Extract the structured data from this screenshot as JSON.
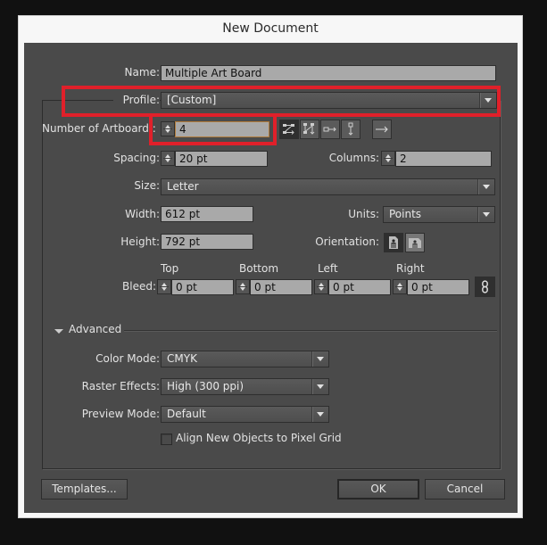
{
  "window": {
    "title": "New Document"
  },
  "form": {
    "name": {
      "label": "Name:",
      "value": "Multiple Art Board"
    },
    "profile": {
      "label": "Profile:",
      "value": "[Custom]"
    },
    "artboards": {
      "label": "Number of Artboard :",
      "value": "4"
    },
    "artboard_layout_icons": [
      "grid-by-row-icon",
      "grid-by-column-icon",
      "arrange-by-row-icon",
      "arrange-by-column-icon",
      "change-to-right-to-left-icon"
    ],
    "spacing": {
      "label": "Spacing:",
      "value": "20 pt"
    },
    "columns": {
      "label": "Columns:",
      "value": "2"
    },
    "size": {
      "label": "Size:",
      "value": "Letter"
    },
    "width": {
      "label": "Width:",
      "value": "612 pt"
    },
    "units": {
      "label": "Units:",
      "value": "Points"
    },
    "height": {
      "label": "Height:",
      "value": "792 pt"
    },
    "orientation": {
      "label": "Orientation:",
      "options": [
        "Portrait",
        "Landscape"
      ],
      "selected": "Portrait"
    },
    "bleed": {
      "label": "Bleed:",
      "top": {
        "label": "Top",
        "value": "0 pt"
      },
      "bottom": {
        "label": "Bottom",
        "value": "0 pt"
      },
      "left": {
        "label": "Left",
        "value": "0 pt"
      },
      "right": {
        "label": "Right",
        "value": "0 pt"
      }
    }
  },
  "advanced": {
    "label": "Advanced",
    "color_mode": {
      "label": "Color Mode:",
      "value": "CMYK"
    },
    "raster_effects": {
      "label": "Raster Effects:",
      "value": "High (300 ppi)"
    },
    "preview_mode": {
      "label": "Preview Mode:",
      "value": "Default"
    },
    "align_pixel_grid": {
      "label": "Align New Objects to Pixel Grid",
      "checked": false
    }
  },
  "buttons": {
    "templates": "Templates...",
    "ok": "OK",
    "cancel": "Cancel"
  },
  "annotation": {
    "highlight_color": "#e0202a"
  }
}
